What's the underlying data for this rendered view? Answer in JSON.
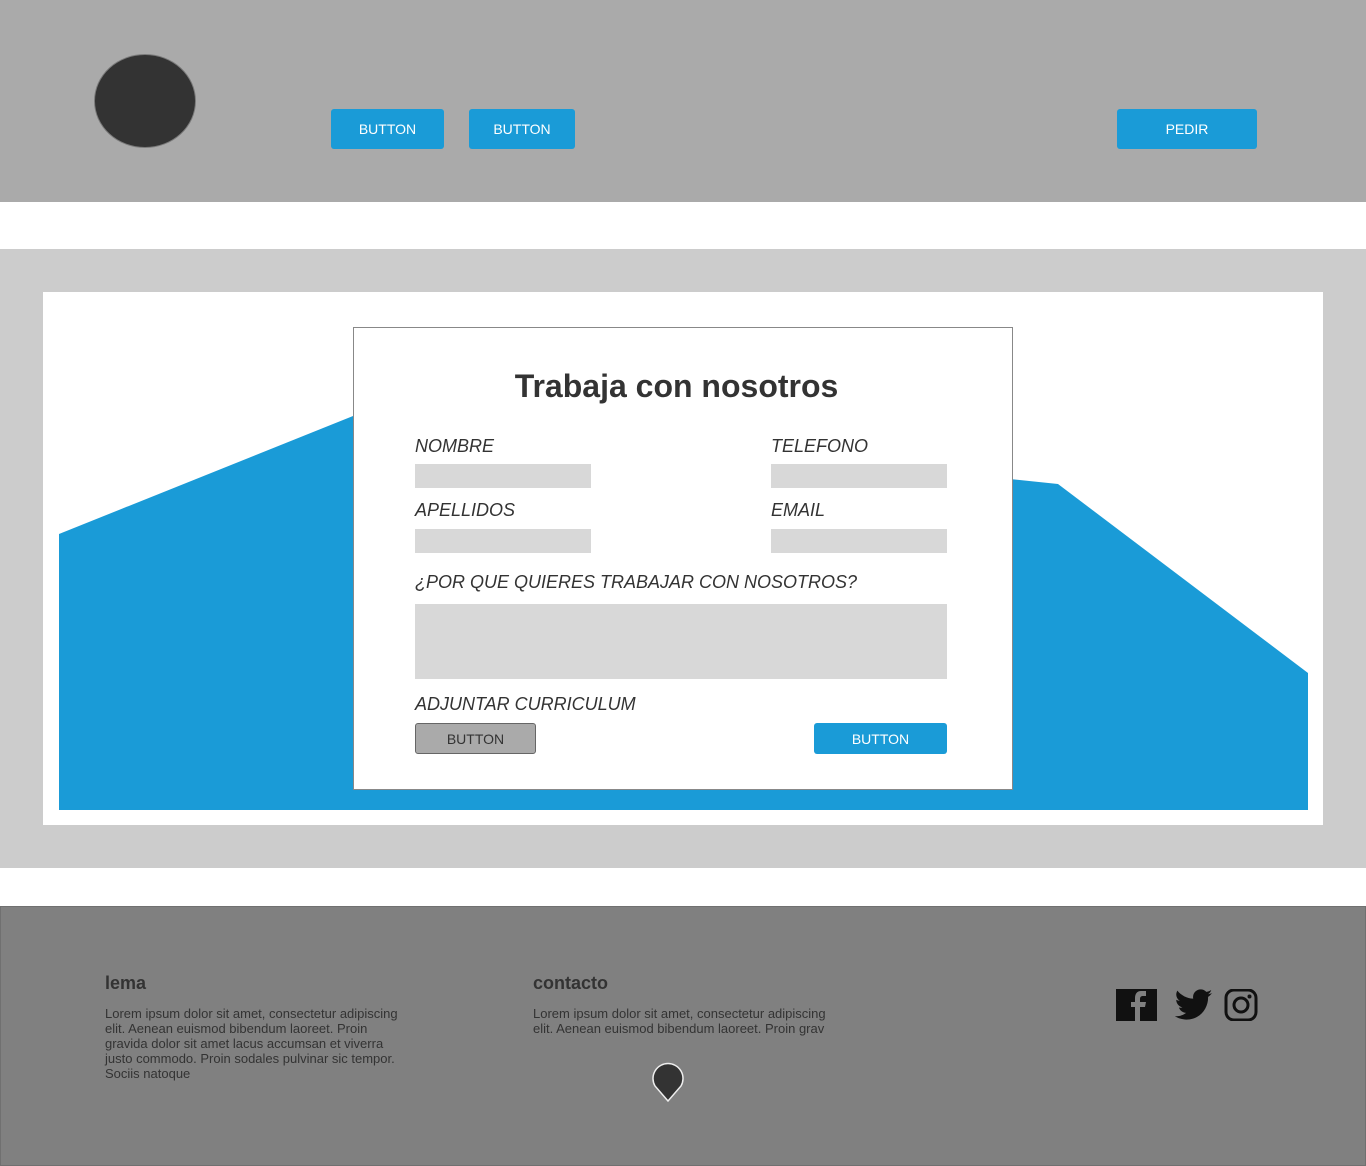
{
  "header": {
    "nav_buttons": [
      "BUTTON",
      "BUTTON"
    ],
    "order_button": "PEDIR"
  },
  "form": {
    "title": "Trabaja con nosotros",
    "labels": {
      "name": "NOMBRE",
      "phone": "TELEFONO",
      "surname": "APELLIDOS",
      "email": "EMAIL",
      "why": "¿POR QUE QUIERES TRABAJAR CON NOSOTROS?",
      "attach": "ADJUNTAR CURRICULUM"
    },
    "attach_button": "BUTTON",
    "submit_button": "BUTTON"
  },
  "footer": {
    "lema_title": "lema",
    "lema_text": "Lorem ipsum dolor sit amet, consectetur adipiscing elit. Aenean euismod bibendum laoreet. Proin gravida dolor sit amet lacus accumsan et viverra justo commodo. Proin sodales pulvinar sic tempor. Sociis natoque",
    "contact_title": "contacto",
    "contact_text": "Lorem ipsum dolor sit amet, consectetur adipiscing elit. Aenean euismod bibendum laoreet. Proin grav",
    "social_icons": [
      "facebook-icon",
      "twitter-icon",
      "instagram-icon"
    ]
  },
  "colors": {
    "header_bg": "#aaaaaa",
    "accent_blue": "#1a9bd7",
    "band_bg": "#cccccc",
    "footer_bg": "#808080",
    "field_bg": "#d8d8d8"
  }
}
